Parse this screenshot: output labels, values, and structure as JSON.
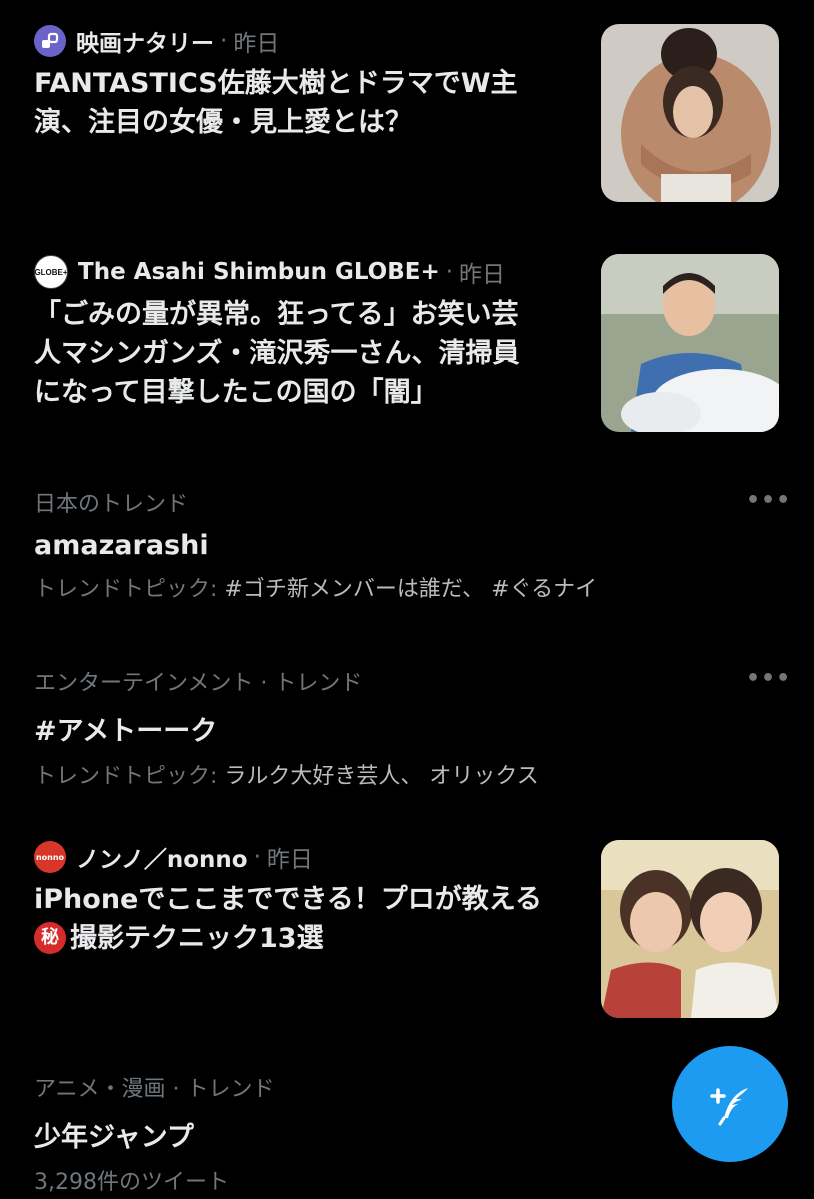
{
  "news": [
    {
      "source": "映画ナタリー",
      "time": "昨日",
      "headline_lines": [
        "FANTASTICS佐藤大樹とドラマでW主",
        "演、注目の女優・見上愛とは？"
      ]
    },
    {
      "source": "The Asahi Shimbun GLOBE+",
      "time": "昨日",
      "headline_lines": [
        "「ごみの量が異常。狂ってる」お笑い芸",
        "人マシンガンズ・滝沢秀一さん、清掃員",
        "になって目撃したこの国の「闇」"
      ]
    },
    {
      "source": "ノンノ／nonno",
      "time": "昨日",
      "headline_lines": [
        "iPhoneでここまでできる！プロが教える",
        "撮影テクニック13選"
      ],
      "badge": "秘"
    }
  ],
  "trends": [
    {
      "category": "日本のトレンド",
      "title": "amazarashi",
      "topics_label": "トレンドトピック: ",
      "topics": "#ゴチ新メンバーは誰だ、 #ぐるナイ",
      "more": "•••"
    },
    {
      "category": "エンターテインメント · トレンド",
      "title": "#アメトーーク",
      "topics_label": "トレンドトピック: ",
      "topics": "ラルク大好き芸人、 オリックス",
      "more": "•••"
    },
    {
      "category": "アニメ・漫画 · トレンド",
      "title": "少年ジャンプ",
      "count": "3,298件のツイート"
    }
  ],
  "source_icons": {
    "natalie": "GLOBE+",
    "nonno": "nonno"
  },
  "colors": {
    "background": "#000000",
    "text": "#e7e9ea",
    "secondary": "#71767b",
    "accent": "#1d9bf0",
    "natalie_icon": "#6b63c9",
    "nonno_icon": "#d9362b"
  },
  "icons": {
    "compose": "compose-tweet-icon",
    "more": "more-dots-icon"
  }
}
